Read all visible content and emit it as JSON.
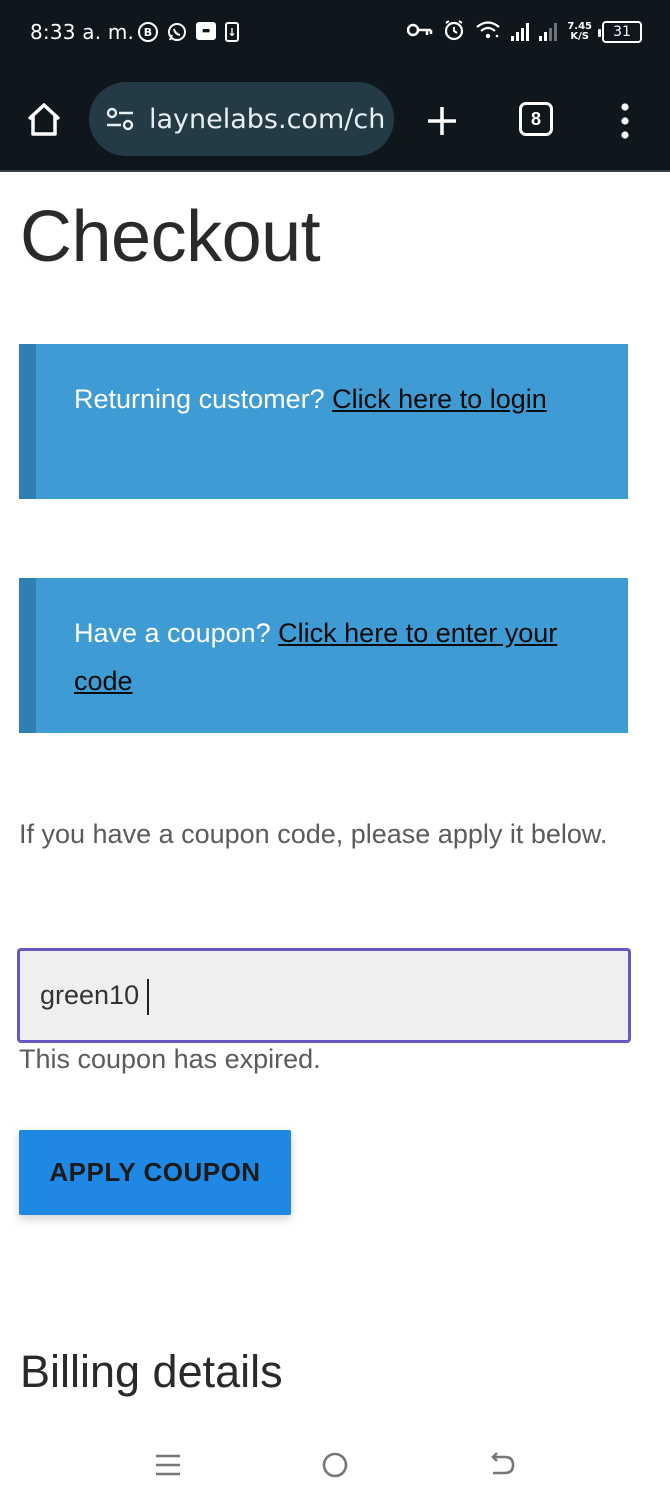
{
  "status_bar": {
    "time": "8:33 a. m.",
    "left_icons": [
      "b-circle-icon",
      "whatsapp-icon",
      "app-notification-icon",
      "download-icon"
    ],
    "right_icons": [
      "vpn-key-icon",
      "alarm-icon",
      "wifi-icon",
      "signal-icon",
      "signal-icon"
    ],
    "net_speed_value": "7.45",
    "net_speed_unit": "K/S",
    "battery": "31"
  },
  "browser": {
    "url": "laynelabs.com/ch",
    "tab_count": "8",
    "icons": [
      "home-icon",
      "site-settings-icon",
      "plus-icon",
      "tabs-icon",
      "overflow-menu-icon"
    ]
  },
  "page": {
    "title": "Checkout",
    "login_notice": {
      "text": "Returning customer?",
      "link": "Click here to login"
    },
    "coupon_notice": {
      "text": "Have a coupon?",
      "link": "Click here to enter your code"
    },
    "coupon_help": "If you have a coupon code, please apply it below.",
    "coupon_value": "green10",
    "coupon_error": "This coupon has expired.",
    "apply_button": "APPLY COUPON",
    "billing_title": "Billing details"
  },
  "colors": {
    "notice_bg": "#3e9bd3",
    "notice_border": "#2f7fb1",
    "button_bg": "#1f88e5",
    "input_focus": "#6a58c2"
  },
  "nav_bar": [
    "recents-icon",
    "home-circle-icon",
    "back-icon"
  ]
}
